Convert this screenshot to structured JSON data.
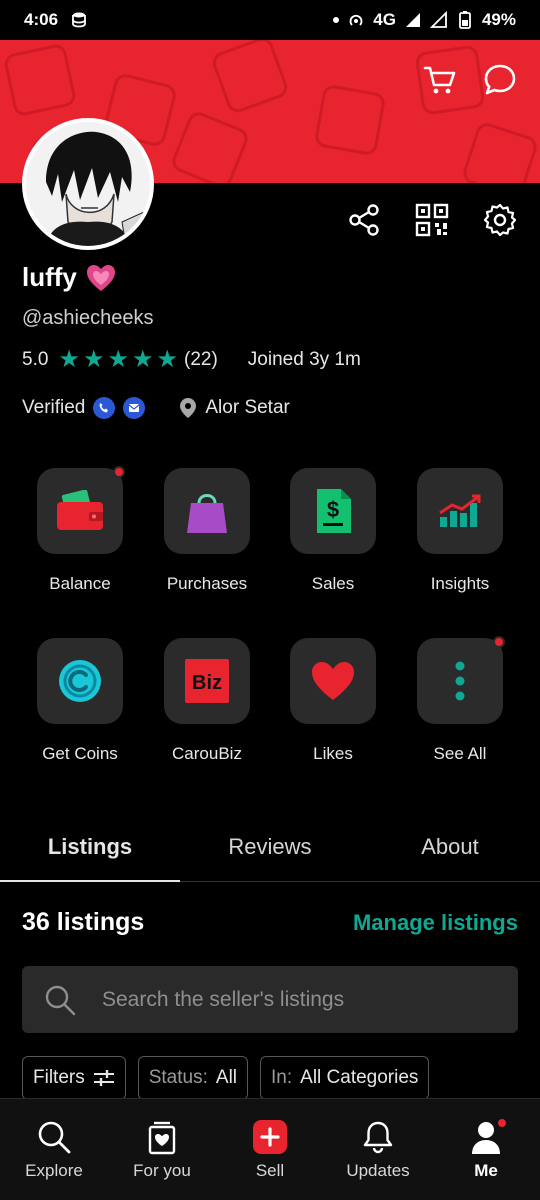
{
  "status_bar": {
    "time": "4:06",
    "network": "4G",
    "battery": "49%"
  },
  "banner": {
    "color": "#e8242e",
    "icons": [
      "cart-icon",
      "chat-icon"
    ]
  },
  "profile": {
    "name": "luffy",
    "handle": "@ashiecheeks",
    "rating": "5.0",
    "stars": 5,
    "review_count": "(22)",
    "joined": "Joined 3y 1m",
    "verified_label": "Verified",
    "location": "Alor Setar",
    "actions": [
      "share-icon",
      "qr-code-icon",
      "settings-icon"
    ]
  },
  "shortcuts": [
    {
      "label": "Balance",
      "icon": "wallet-icon",
      "badge": true
    },
    {
      "label": "Purchases",
      "icon": "shopping-bag-icon",
      "badge": false
    },
    {
      "label": "Sales",
      "icon": "dollar-document-icon",
      "badge": false
    },
    {
      "label": "Insights",
      "icon": "chart-growth-icon",
      "badge": false
    },
    {
      "label": "Get Coins",
      "icon": "coin-icon",
      "badge": false
    },
    {
      "label": "CarouBiz",
      "icon": "biz-icon",
      "badge": false
    },
    {
      "label": "Likes",
      "icon": "heart-icon",
      "badge": false
    },
    {
      "label": "See All",
      "icon": "more-vertical-icon",
      "badge": true
    }
  ],
  "tabs": [
    {
      "label": "Listings",
      "active": true
    },
    {
      "label": "Reviews",
      "active": false
    },
    {
      "label": "About",
      "active": false
    }
  ],
  "listings": {
    "count_label": "36 listings",
    "manage_label": "Manage listings",
    "search_placeholder": "Search the seller's listings"
  },
  "filters": {
    "filters_label": "Filters",
    "status_prefix": "Status:",
    "status_value": "All",
    "in_prefix": "In:",
    "in_value": "All Categories"
  },
  "bottom_nav": [
    {
      "label": "Explore",
      "icon": "search-icon",
      "active": false
    },
    {
      "label": "For you",
      "icon": "for-you-icon",
      "active": false
    },
    {
      "label": "Sell",
      "icon": "plus-icon",
      "active": false
    },
    {
      "label": "Updates",
      "icon": "bell-icon",
      "active": false
    },
    {
      "label": "Me",
      "icon": "user-icon",
      "active": true
    }
  ],
  "colors": {
    "accent": "#0fa892",
    "brand_red": "#e8242e",
    "tile_bg": "#2b2b2b"
  }
}
